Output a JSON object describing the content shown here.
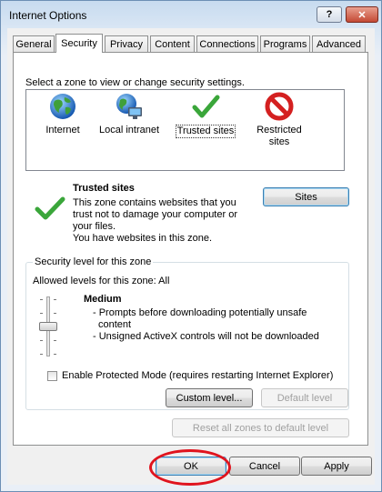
{
  "window": {
    "title": "Internet Options",
    "help_label": "?",
    "close_label": "✕"
  },
  "tabs": [
    {
      "label": "General",
      "active": false
    },
    {
      "label": "Security",
      "active": true
    },
    {
      "label": "Privacy",
      "active": false
    },
    {
      "label": "Content",
      "active": false
    },
    {
      "label": "Connections",
      "active": false
    },
    {
      "label": "Programs",
      "active": false
    },
    {
      "label": "Advanced",
      "active": false
    }
  ],
  "zones": {
    "prompt": "Select a zone to view or change security settings.",
    "items": [
      {
        "label": "Internet",
        "icon": "globe-icon"
      },
      {
        "label": "Local intranet",
        "icon": "intranet-icon"
      },
      {
        "label": "Trusted sites",
        "icon": "checkmark-icon",
        "selected": true
      },
      {
        "label": "Restricted sites",
        "icon": "no-entry-icon"
      }
    ]
  },
  "selected_zone": {
    "title": "Trusted sites",
    "description_lines": [
      "This zone contains websites that you",
      "trust not to damage your computer or",
      "your files.",
      "You have websites in this zone."
    ],
    "sites_button": "Sites"
  },
  "security_level": {
    "legend": "Security level for this zone",
    "allowed": "Allowed levels for this zone: All",
    "level_name": "Medium",
    "level_lines": [
      "- Prompts before downloading potentially unsafe",
      "content",
      "- Unsigned ActiveX controls will not be downloaded"
    ],
    "protected_mode_label": "Enable Protected Mode (requires restarting Internet Explorer)",
    "protected_mode_checked": false,
    "custom_level_button": "Custom level...",
    "default_level_button": "Default level"
  },
  "reset_all_button": "Reset all zones to default level",
  "footer": {
    "ok": "OK",
    "cancel": "Cancel",
    "apply": "Apply"
  },
  "annotation_color": "#e0141e"
}
